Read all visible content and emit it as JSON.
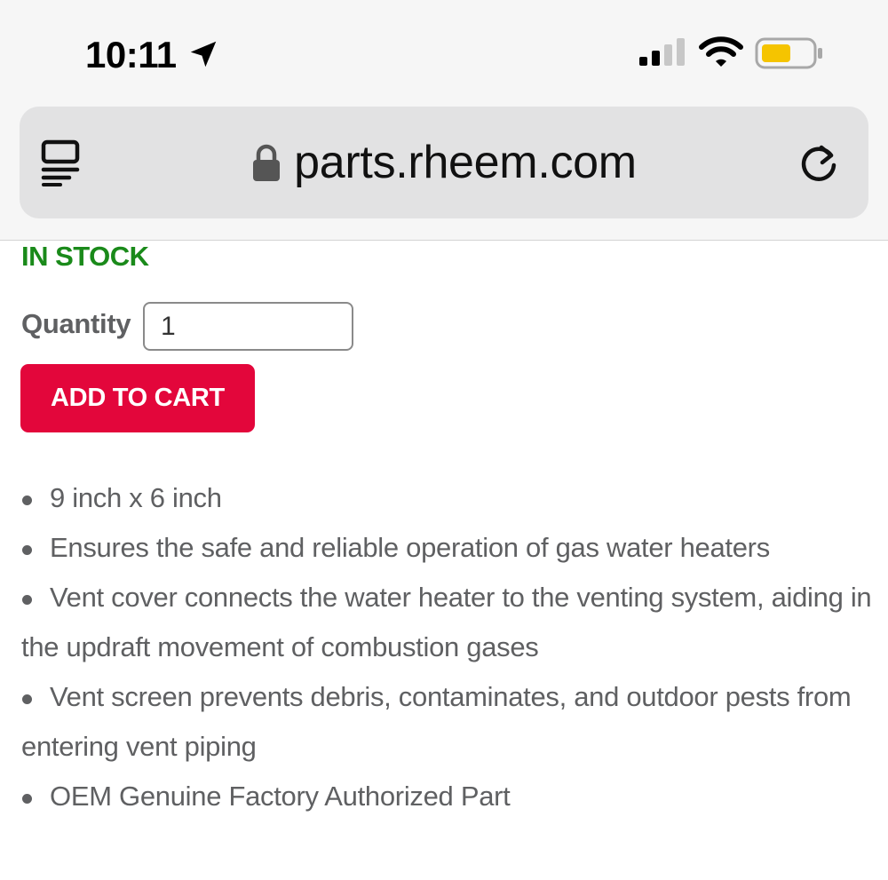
{
  "status_bar": {
    "time": "10:11",
    "icons": [
      "location-arrow-icon",
      "cellular-signal-icon",
      "wifi-icon",
      "battery-icon"
    ],
    "battery_color": "#f5c400",
    "signal_bars_active": 2,
    "signal_bars_total": 4
  },
  "browser": {
    "url": "parts.rheem.com",
    "icons": [
      "reader-view-icon",
      "lock-icon",
      "reload-icon"
    ]
  },
  "product": {
    "stock_status": "IN STOCK",
    "stock_color": "#1a8a1a",
    "quantity_label": "Quantity",
    "quantity_value": "1",
    "add_to_cart_label": "ADD TO CART",
    "add_to_cart_color": "#e3063b",
    "features": [
      "9 inch x 6 inch",
      "Ensures the safe and reliable operation of gas water heaters",
      "Vent cover connects the water heater to the venting system, aiding in the updraft movement of combustion gases",
      "Vent screen prevents debris, contaminates, and outdoor pests from entering vent piping",
      "OEM Genuine Factory Authorized Part"
    ]
  }
}
